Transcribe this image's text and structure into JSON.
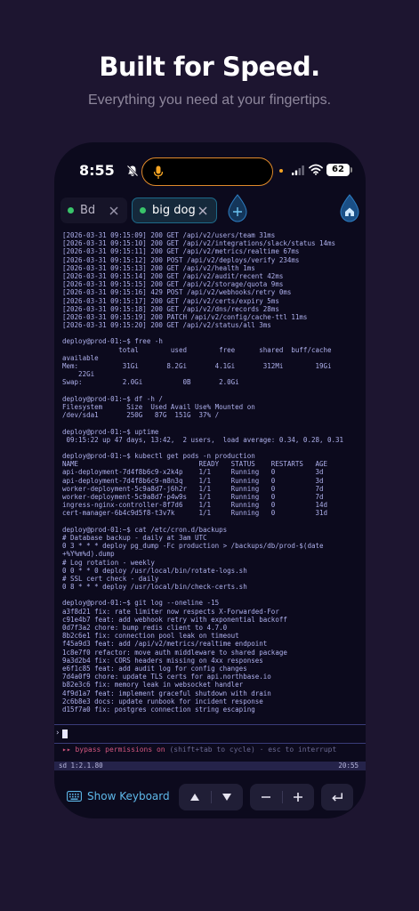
{
  "hero": {
    "title": "Built for Speed.",
    "subtitle": "Everything you need at your fingertips."
  },
  "status_bar": {
    "time": "8:55",
    "battery": "62"
  },
  "tabs": [
    {
      "label": "Bd",
      "active": false
    },
    {
      "label": "big dog",
      "active": true
    }
  ],
  "terminal": {
    "lines": [
      "[2026-03-31 09:15:09] 200 GET /api/v2/users/team 31ms",
      "[2026-03-31 09:15:10] 200 GET /api/v2/integrations/slack/status 14ms",
      "[2026-03-31 09:15:11] 200 GET /api/v2/metrics/realtime 67ms",
      "[2026-03-31 09:15:12] 200 POST /api/v2/deploys/verify 234ms",
      "[2026-03-31 09:15:13] 200 GET /api/v2/health 1ms",
      "[2026-03-31 09:15:14] 200 GET /api/v2/audit/recent 42ms",
      "[2026-03-31 09:15:15] 200 GET /api/v2/storage/quota 9ms",
      "[2026-03-31 09:15:16] 429 POST /api/v2/webhooks/retry 0ms",
      "[2026-03-31 09:15:17] 200 GET /api/v2/certs/expiry 5ms",
      "[2026-03-31 09:15:18] 200 GET /api/v2/dns/records 28ms",
      "[2026-03-31 09:15:19] 200 PATCH /api/v2/config/cache-ttl 11ms",
      "[2026-03-31 09:15:20] 200 GET /api/v2/status/all 3ms",
      "",
      "deploy@prod-01:~$ free -h",
      "              total        used        free      shared  buff/cache",
      "available",
      "Mem:           31Gi       8.2Gi       4.1Gi       312Mi        19Gi",
      "    22Gi",
      "Swap:          2.0Gi          0B       2.0Gi",
      "",
      "deploy@prod-01:~$ df -h /",
      "Filesystem      Size  Used Avail Use% Mounted on",
      "/dev/sda1       250G   87G  151G  37% /",
      "",
      "deploy@prod-01:~$ uptime",
      " 09:15:22 up 47 days, 13:42,  2 users,  load average: 0.34, 0.28, 0.31",
      "",
      "deploy@prod-01:~$ kubectl get pods -n production",
      "NAME                              READY   STATUS    RESTARTS   AGE",
      "api-deployment-7d4f8b6c9-x2k4p    1/1     Running   0          3d",
      "api-deployment-7d4f8b6c9-m8n3q    1/1     Running   0          3d",
      "worker-deployment-5c9a8d7-j6h2r   1/1     Running   0          7d",
      "worker-deployment-5c9a8d7-p4w9s   1/1     Running   0          7d",
      "ingress-nginx-controller-8f7d6    1/1     Running   0          14d",
      "cert-manager-6b4c9d5f8-t3v7k      1/1     Running   0          31d",
      "",
      "deploy@prod-01:~$ cat /etc/cron.d/backups",
      "# Database backup - daily at 3am UTC",
      "0 3 * * * deploy pg_dump -Fc production > /backups/db/prod-$(date",
      "+%Y%m%d).dump",
      "# Log rotation - weekly",
      "0 0 * * 0 deploy /usr/local/bin/rotate-logs.sh",
      "# SSL cert check - daily",
      "0 8 * * * deploy /usr/local/bin/check-certs.sh",
      "",
      "deploy@prod-01:~$ git log --oneline -15",
      "a3f8d21 fix: rate limiter now respects X-Forwarded-For",
      "c91e4b7 feat: add webhook retry with exponential backoff",
      "0d7f3a2 chore: bump redis client to 4.7.0",
      "8b2c6e1 fix: connection pool leak on timeout",
      "f45a9d3 feat: add /api/v2/metrics/realtime endpoint",
      "1c8e7f0 refactor: move auth middleware to shared package",
      "9a3d2b4 fix: CORS headers missing on 4xx responses",
      "e6f1c85 feat: add audit log for config changes",
      "7d4a0f9 chore: update TLS certs for api.northbase.io",
      "b82e3c6 fix: memory leak in websocket handler",
      "4f9d1a7 feat: implement graceful shutdown with drain",
      "2c6b8e3 docs: update runbook for incident response",
      "d15f7a0 fix: postgres connection string escaping"
    ]
  },
  "prompt": {
    "chevron": "›"
  },
  "bypass": {
    "arrows": "▸▸",
    "text": "bypass permissions on",
    "hint": "(shift+tab to cycle) · esc to interrupt"
  },
  "tmux": {
    "left": "sd  1:2.1.80",
    "right": "20:55"
  },
  "toolbar": {
    "keyboard_label": "Show Keyboard"
  },
  "colors": {
    "background": "#1d1530",
    "terminal_bg": "#0c0a1d",
    "terminal_text": "#aeb0ec",
    "accent_blue": "#5eb8ea",
    "bypass_pink": "#d2567e",
    "tab_dot_green": "#39c46a"
  }
}
